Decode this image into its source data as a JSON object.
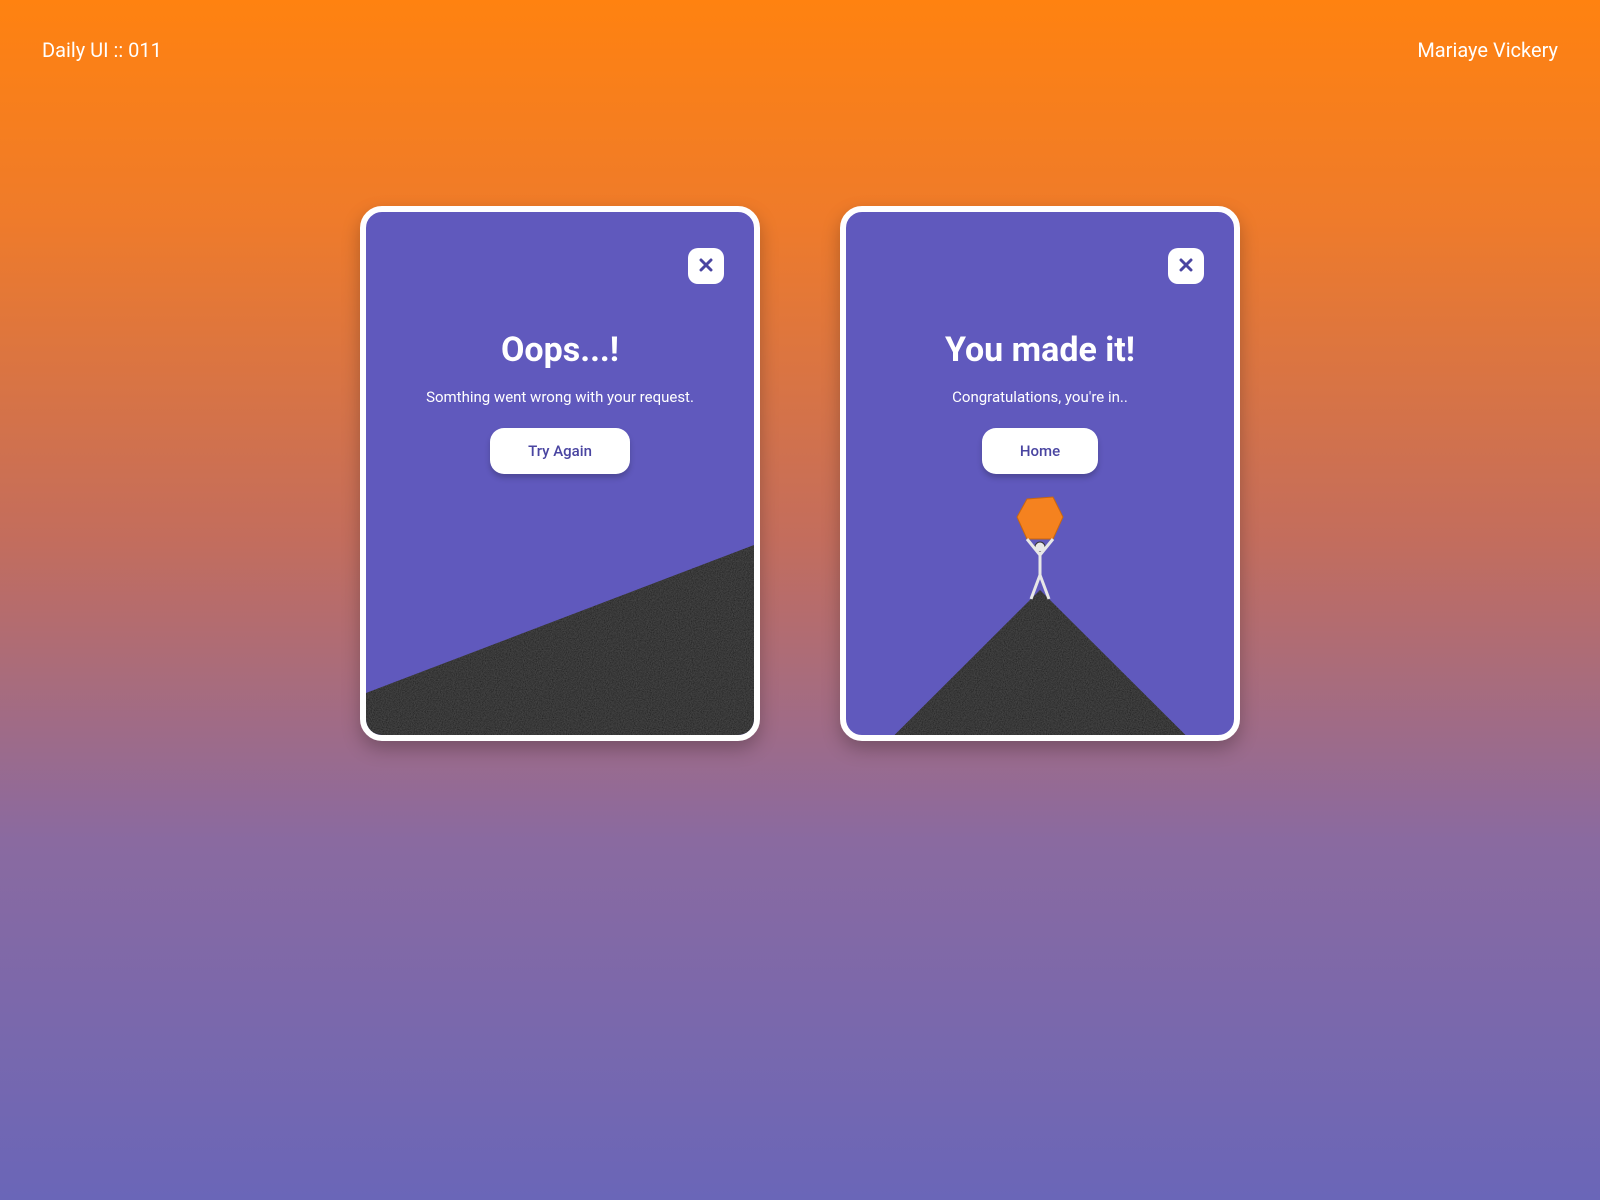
{
  "header": {
    "left": "Daily UI :: 011",
    "right": "Mariaye Vickery"
  },
  "cards": {
    "error": {
      "title": "Oops...!",
      "subtitle": "Somthing went wrong with your request.",
      "button": "Try Again",
      "close_icon": "close-icon"
    },
    "success": {
      "title": "You made it!",
      "subtitle": "Congratulations, you're in..",
      "button": "Home",
      "close_icon": "close-icon"
    }
  },
  "colors": {
    "card_bg": "#6059bd",
    "accent_orange": "#f5821f",
    "white": "#ffffff",
    "dark": "#121212"
  }
}
